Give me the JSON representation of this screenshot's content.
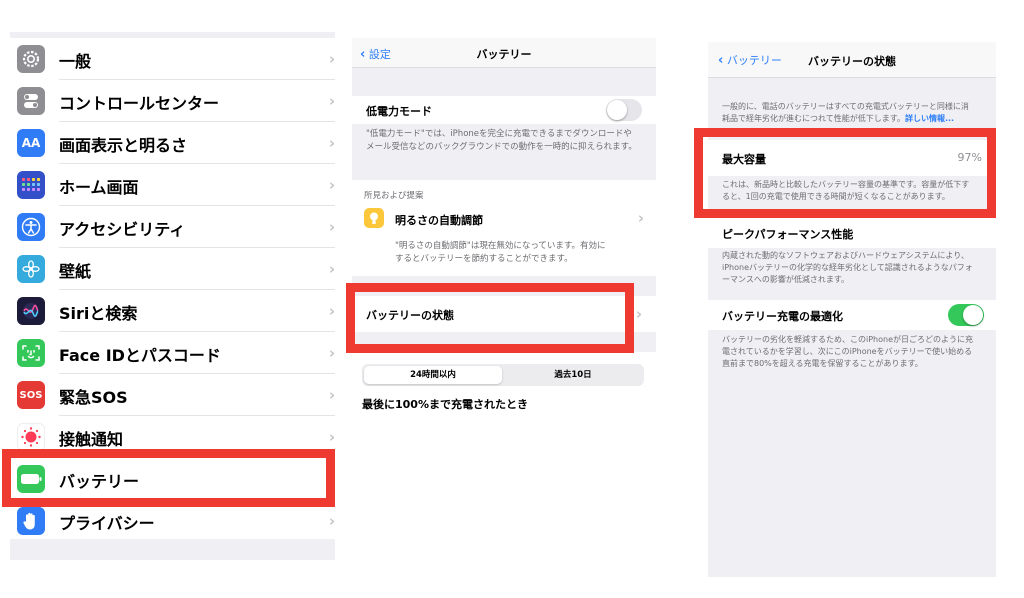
{
  "settings_list": {
    "items": [
      {
        "label": "一般",
        "icon": "gear-icon",
        "color": "#8e8e93"
      },
      {
        "label": "コントロールセンター",
        "icon": "switches-icon",
        "color": "#8e8e93"
      },
      {
        "label": "画面表示と明るさ",
        "icon": "text-size-icon",
        "glyph": "AA",
        "color": "#2f7cf6"
      },
      {
        "label": "ホーム画面",
        "icon": "home-grid-icon",
        "color": "#3450c9"
      },
      {
        "label": "アクセシビリティ",
        "icon": "accessibility-icon",
        "color": "#2f7cf6"
      },
      {
        "label": "壁紙",
        "icon": "flower-icon",
        "color": "#35aadc"
      },
      {
        "label": "Siriと検索",
        "icon": "siri-icon",
        "color": "#1c1c3a"
      },
      {
        "label": "Face IDとパスコード",
        "icon": "face-id-icon",
        "color": "#34c759"
      },
      {
        "label": "緊急SOS",
        "icon": "sos-icon",
        "glyph": "SOS",
        "color": "#e53935"
      },
      {
        "label": "接触通知",
        "icon": "exposure-icon",
        "color": "#ffffff"
      },
      {
        "label": "バッテリー",
        "icon": "battery-icon",
        "color": "#34c759"
      },
      {
        "label": "プライバシー",
        "icon": "hand-icon",
        "color": "#2f7cf6"
      }
    ]
  },
  "battery_screen": {
    "back_label": "設定",
    "title": "バッテリー",
    "low_power_label": "低電力モード",
    "low_power_desc_1": "\"低電力モード\"では、iPhoneを完全に充電できるまでダウンロードや",
    "low_power_desc_2": "メール受信などのバックグラウンドでの動作を一時的に抑えられます。",
    "suggestions_header": "所見および提案",
    "auto_brightness_label": "明るさの自動調節",
    "auto_brightness_desc_1": "\"明るさの自動調節\"は現在無効になっています。有効に",
    "auto_brightness_desc_2": "するとバッテリーを節約することができます。",
    "health_label": "バッテリーの状態",
    "seg_24h": "24時間以内",
    "seg_10d": "過去10日",
    "last_charged": "最後に100%まで充電されたとき"
  },
  "health_screen": {
    "back_label": "バッテリー",
    "title": "バッテリーの状態",
    "intro_1": "一般的に、電話のバッテリーはすべての充電式バッテリーと同様に消",
    "intro_2": "耗品で経年劣化が進むにつれて性能が低下します。",
    "learn_more": "詳しい情報...",
    "max_capacity_label": "最大容量",
    "max_capacity_value": "97%",
    "capacity_desc_1": "これは、新品時と比較したバッテリー容量の基準です。容量が低下す",
    "capacity_desc_2": "ると、1回の充電で使用できる時間が短くなることがあります。",
    "peak_label": "ピークパフォーマンス性能",
    "peak_desc_1": "内蔵された動的なソフトウェアおよびハードウェアシステムにより、",
    "peak_desc_2": "iPhoneバッテリーの化学的な経年劣化として認識されるようなパフォ",
    "peak_desc_3": "ーマンスへの影響が低減されます。",
    "optimized_label": "バッテリー充電の最適化",
    "optimized_desc_1": "バッテリーの劣化を軽減するため、このiPhoneが日ごろどのように充",
    "optimized_desc_2": "電されているかを学習し、次にこのiPhoneをバッテリーで使い始める",
    "optimized_desc_3": "直前まで80%を超える充電を保留することがあります。"
  },
  "colors": {
    "accent": "#2f7ff7",
    "highlight": "#ee3a30",
    "switch_on": "#34c759",
    "switch_off": "#e5e5ea"
  }
}
